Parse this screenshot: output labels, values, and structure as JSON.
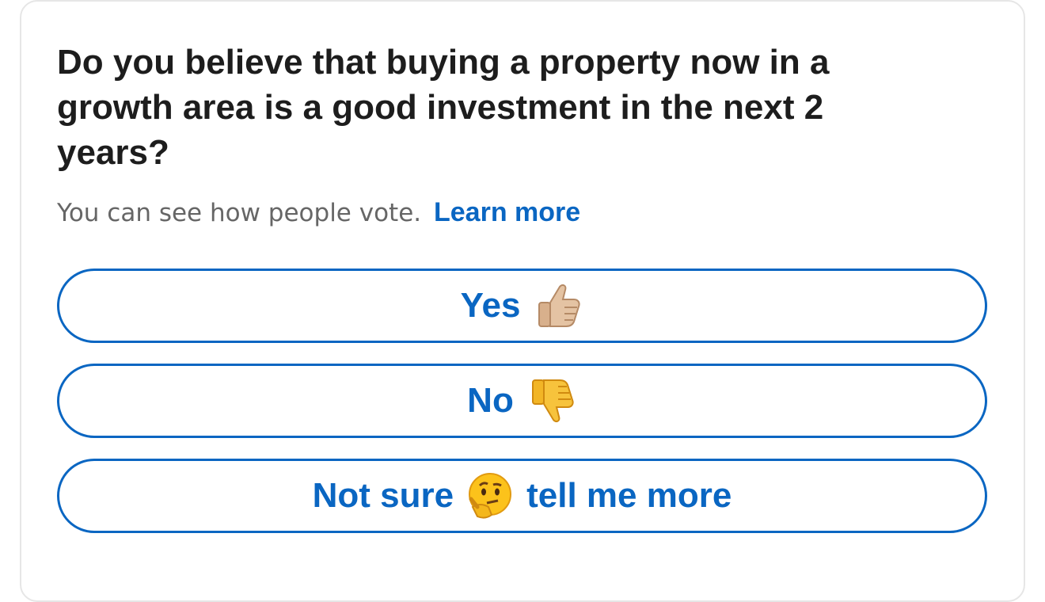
{
  "poll": {
    "question": "Do you believe that buying a property now in a growth area is a good investment in the next 2 years?",
    "visibility_note": "You can see how people vote.",
    "learn_more_label": "Learn more",
    "options": [
      {
        "label": "Yes",
        "emoji": "thumbs-up-icon"
      },
      {
        "label": "No",
        "emoji": "thumbs-down-icon"
      },
      {
        "label_before": "Not sure",
        "emoji": "thinking-face-icon",
        "label_after": "tell me more"
      }
    ]
  },
  "colors": {
    "accent": "#0a66c2",
    "question_text": "#1d1d1d",
    "secondary_text": "#666666",
    "card_border": "#e6e6e6"
  }
}
